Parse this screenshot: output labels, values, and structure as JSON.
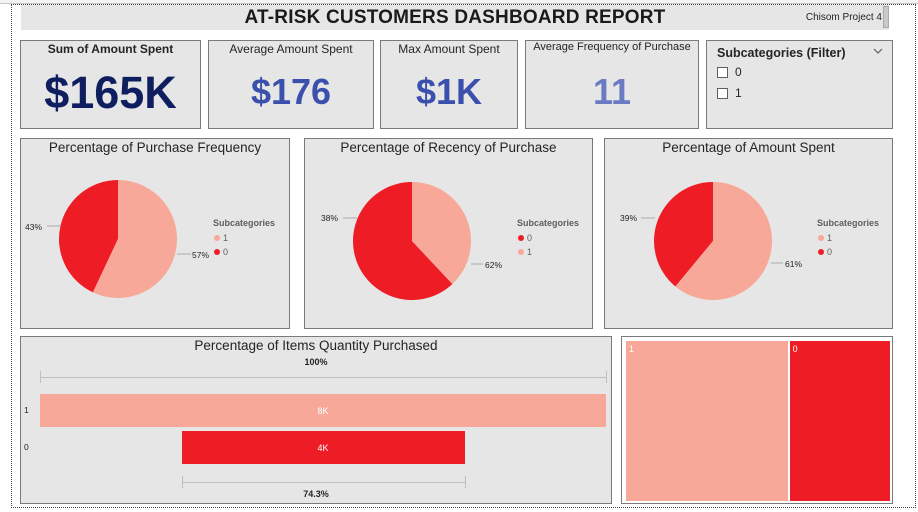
{
  "header": {
    "title": "AT-RISK CUSTOMERS DASHBOARD REPORT",
    "project": "Chisom Project 4"
  },
  "kpis": [
    {
      "label": "Sum of Amount Spent",
      "value": "$165K",
      "color": "#0f1e5e"
    },
    {
      "label": "Average Amount Spent",
      "value": "$176",
      "color": "#3b4fad"
    },
    {
      "label": "Max Amount Spent",
      "value": "$1K",
      "color": "#3b4fad"
    },
    {
      "label": "Average Frequency of Purchase",
      "value": "11",
      "color": "#6a7bc4"
    }
  ],
  "filter": {
    "title": "Subcategories (Filter)",
    "options": [
      "0",
      "1"
    ]
  },
  "colors": {
    "cat0": "#ee1c25",
    "cat1": "#f7a898"
  },
  "pies": [
    {
      "title": "Percentage of Purchase Frequency",
      "legend_title": "Subcategories",
      "legend": [
        "1",
        "0"
      ],
      "label_0": "43%",
      "label_1": "57%",
      "chart_data": {
        "type": "pie",
        "slices": [
          {
            "category": "0",
            "percent": 43
          },
          {
            "category": "1",
            "percent": 57
          }
        ]
      }
    },
    {
      "title": "Percentage of Recency of Purchase",
      "legend_title": "Subcategories",
      "legend": [
        "0",
        "1"
      ],
      "label_0": "62%",
      "label_1": "38%",
      "chart_data": {
        "type": "pie",
        "slices": [
          {
            "category": "0",
            "percent": 62
          },
          {
            "category": "1",
            "percent": 38
          }
        ]
      }
    },
    {
      "title": "Percentage of Amount Spent",
      "legend_title": "Subcategories",
      "legend": [
        "1",
        "0"
      ],
      "label_0": "39%",
      "label_1": "61%",
      "chart_data": {
        "type": "pie",
        "slices": [
          {
            "category": "0",
            "percent": 39
          },
          {
            "category": "1",
            "percent": 61
          }
        ]
      }
    }
  ],
  "funnel": {
    "title": "Percentage of Items Quantity Purchased",
    "top_pct": "100%",
    "bottom_pct": "74.3%",
    "categories": [
      "1",
      "0"
    ],
    "value_labels": [
      "8K",
      "4K"
    ],
    "chart_data": {
      "type": "bar",
      "categories": [
        "1",
        "0"
      ],
      "values": [
        8000,
        4000
      ],
      "conversion_percent": [
        100,
        74.3
      ]
    }
  },
  "treemap": {
    "cells": [
      {
        "label": "1",
        "share": 0.617
      },
      {
        "label": "0",
        "share": 0.383
      }
    ]
  }
}
